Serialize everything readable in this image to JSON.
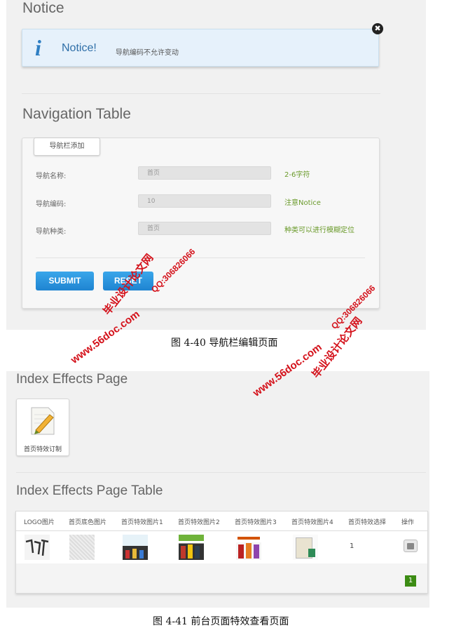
{
  "notice": {
    "title": "Notice",
    "heading": "Notice!",
    "text": "导航编码不允许变动",
    "info_icon": "i",
    "close_icon": "✖"
  },
  "nav_table": {
    "title": "Navigation Table",
    "tab_label": "导航栏添加",
    "rows": [
      {
        "label": "导航名称:",
        "value": "首页",
        "hint": "2-6字符"
      },
      {
        "label": "导航编码:",
        "value": "10",
        "hint": "注意Notice"
      },
      {
        "label": "导航种类:",
        "value": "首页",
        "hint": "种类可以进行模糊定位"
      }
    ],
    "submit_label": "SUBMIT",
    "reset_label": "RESET"
  },
  "caption1": "图 4-40   导航栏编辑页面",
  "effects": {
    "title": "Index Effects Page",
    "card_label": "首页特效订制",
    "table_title": "Index Effects Page Table",
    "headers": [
      "LOGO图片",
      "首页底色图片",
      "首页特效图片1",
      "首页特效图片2",
      "首页特效图片3",
      "首页特效图片4",
      "首页特效选择",
      "操作"
    ],
    "row_select": "1",
    "page_number": "1"
  },
  "caption2": "图 4-41   前台页面特效查看页面",
  "watermark": {
    "site": "www.56doc.com",
    "name": "毕业设计论文网",
    "qq": "QQ:306826066"
  },
  "colors": {
    "accent_blue": "#1f84d1",
    "hint_green": "#6a9a2a",
    "watermark_red": "#d4111a",
    "page_green": "#3c8c14"
  }
}
